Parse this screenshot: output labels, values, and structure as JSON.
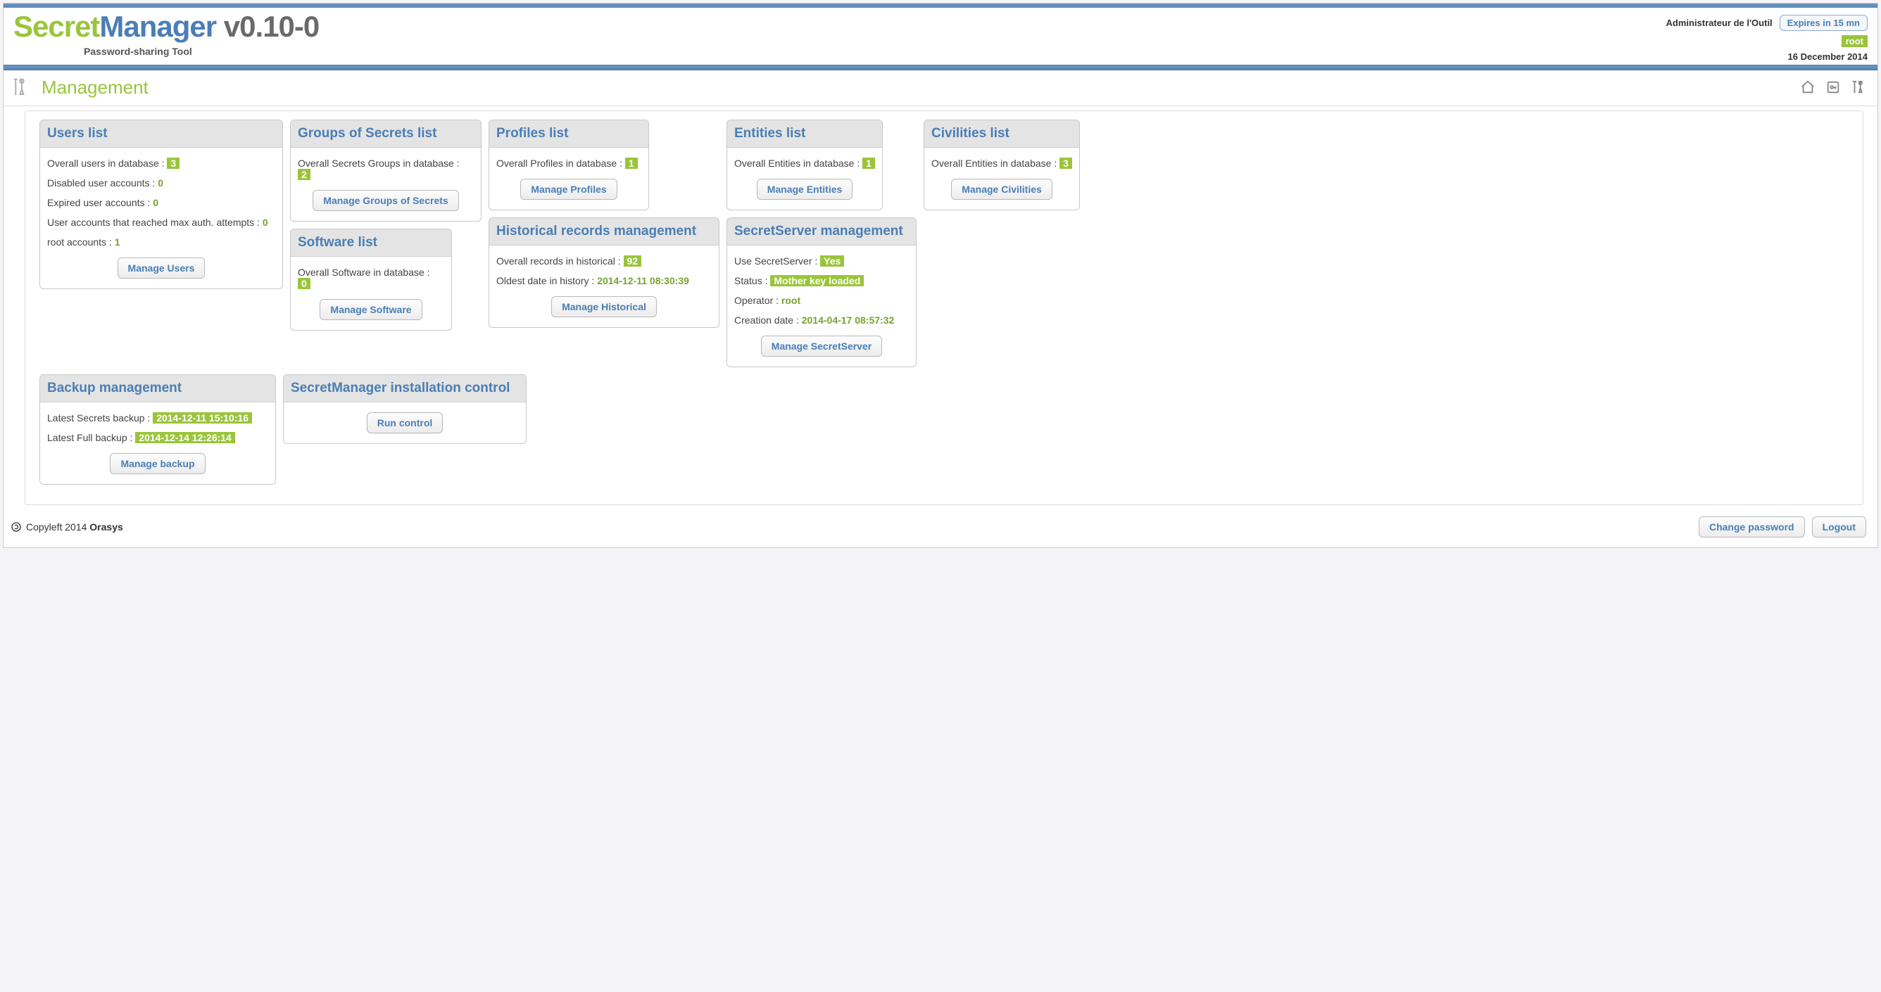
{
  "header": {
    "logo_secret": "Secret",
    "logo_manager": "Manager",
    "version": " v0.10-0",
    "subtitle": "Password-sharing Tool",
    "user": "Administrateur de l'Outil",
    "expires": "Expires in 15 mn",
    "root_badge": "root",
    "date": "16 December 2014"
  },
  "section": {
    "title": "Management"
  },
  "cards": {
    "users": {
      "title": "Users list",
      "overall_label": "Overall users in database : ",
      "overall_value": "3",
      "disabled_label": "Disabled user accounts : ",
      "disabled_value": "0",
      "expired_label": "Expired user accounts : ",
      "expired_value": "0",
      "maxauth_label": "User accounts that reached max auth. attempts : ",
      "maxauth_value": "0",
      "root_label": "root accounts : ",
      "root_value": "1",
      "button": "Manage Users"
    },
    "groups": {
      "title": "Groups of Secrets list",
      "overall_label": "Overall Secrets Groups in database : ",
      "overall_value": "2",
      "button": "Manage Groups of Secrets"
    },
    "profiles": {
      "title": "Profiles list",
      "overall_label": "Overall Profiles in database : ",
      "overall_value": "1",
      "button": "Manage Profiles"
    },
    "entities": {
      "title": "Entities list",
      "overall_label": "Overall Entities in database : ",
      "overall_value": "1",
      "button": "Manage Entities"
    },
    "civilities": {
      "title": "Civilities list",
      "overall_label": "Overall Entities in database : ",
      "overall_value": "3",
      "button": "Manage Civilities"
    },
    "software": {
      "title": "Software list",
      "overall_label": "Overall Software in database : ",
      "overall_value": "0",
      "button": "Manage Software"
    },
    "historical": {
      "title": "Historical records management",
      "records_label": "Overall records in historical : ",
      "records_value": "92",
      "oldest_label": "Oldest date in history :  ",
      "oldest_value": "2014-12-11 08:30:39",
      "button": "Manage Historical"
    },
    "secretserver": {
      "title": "SecretServer management",
      "use_label": "Use SecretServer : ",
      "use_value": "Yes",
      "status_label": "Status : ",
      "status_value": "Mother key loaded",
      "operator_label": "Operator : ",
      "operator_value": "root",
      "creation_label": "Creation date : ",
      "creation_value": "2014-04-17 08:57:32",
      "button": "Manage SecretServer"
    },
    "backup": {
      "title": "Backup management",
      "secrets_label": "Latest Secrets backup : ",
      "secrets_value": "2014-12-11 15:10:16",
      "full_label": "Latest Full backup : ",
      "full_value": "2014-12-14 12:26:14",
      "button": "Manage backup"
    },
    "install": {
      "title": "SecretManager installation control",
      "button": "Run control"
    }
  },
  "footer": {
    "copyleft": "Copyleft 2014 ",
    "brand": "Orasys",
    "change_password": "Change password",
    "logout": "Logout"
  }
}
